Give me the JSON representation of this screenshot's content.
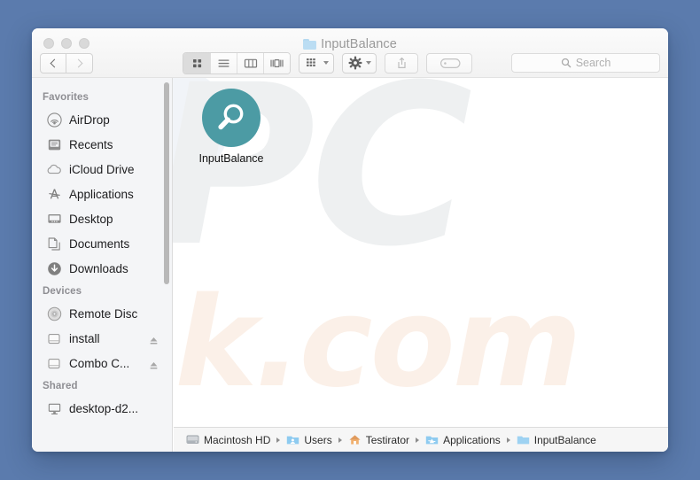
{
  "desktop": {
    "background_color": "#5b7bad"
  },
  "window": {
    "title": "InputBalance",
    "title_icon": "folder-icon",
    "traffic_lights": [
      {
        "name": "close-button",
        "color": "#d9d9d9"
      },
      {
        "name": "minimize-button",
        "color": "#d9d9d9"
      },
      {
        "name": "maximize-button",
        "color": "#d9d9d9"
      }
    ]
  },
  "toolbar": {
    "back_label": "Back",
    "forward_label": "Forward",
    "view_modes": [
      {
        "name": "icon-view",
        "label": "Icon View",
        "selected": true
      },
      {
        "name": "list-view",
        "label": "List View",
        "selected": false
      },
      {
        "name": "column-view",
        "label": "Column View",
        "selected": false
      },
      {
        "name": "gallery-view",
        "label": "Gallery View",
        "selected": false
      }
    ],
    "arrange_label": "Arrange",
    "action_label": "Action",
    "share_label": "Share",
    "tags_label": "Edit Tags"
  },
  "search": {
    "placeholder": "Search",
    "value": ""
  },
  "sidebar": {
    "sections": [
      {
        "heading": "Favorites",
        "items": [
          {
            "label": "AirDrop",
            "icon": "airdrop-icon",
            "eject": false
          },
          {
            "label": "Recents",
            "icon": "recents-icon",
            "eject": false
          },
          {
            "label": "iCloud Drive",
            "icon": "icloud-icon",
            "eject": false
          },
          {
            "label": "Applications",
            "icon": "applications-icon",
            "eject": false
          },
          {
            "label": "Desktop",
            "icon": "desktop-icon",
            "eject": false
          },
          {
            "label": "Documents",
            "icon": "documents-icon",
            "eject": false
          },
          {
            "label": "Downloads",
            "icon": "downloads-icon",
            "eject": false
          }
        ]
      },
      {
        "heading": "Devices",
        "items": [
          {
            "label": "Remote Disc",
            "icon": "disc-icon",
            "eject": false
          },
          {
            "label": "install",
            "icon": "harddrive-icon",
            "eject": true
          },
          {
            "label": "Combo C...",
            "icon": "harddrive-icon",
            "eject": true
          }
        ]
      },
      {
        "heading": "Shared",
        "items": [
          {
            "label": "desktop-d2...",
            "icon": "display-icon",
            "eject": false
          }
        ]
      }
    ]
  },
  "content": {
    "files": [
      {
        "label": "InputBalance",
        "icon": "magnifier-app-icon",
        "icon_background": "#4c9ba4",
        "icon_foreground": "#ffffff"
      }
    ],
    "watermark": {
      "primary_text": "PC",
      "primary_color": "#eef0f1",
      "secondary_text": "sk.com",
      "secondary_color": "#fbf0e8"
    }
  },
  "pathbar": {
    "crumbs": [
      {
        "label": "Macintosh HD",
        "icon": "harddrive-icon"
      },
      {
        "label": "Users",
        "icon": "users-folder-icon"
      },
      {
        "label": "Testirator",
        "icon": "home-folder-icon"
      },
      {
        "label": "Applications",
        "icon": "applications-folder-icon"
      },
      {
        "label": "InputBalance",
        "icon": "folder-icon"
      }
    ]
  }
}
